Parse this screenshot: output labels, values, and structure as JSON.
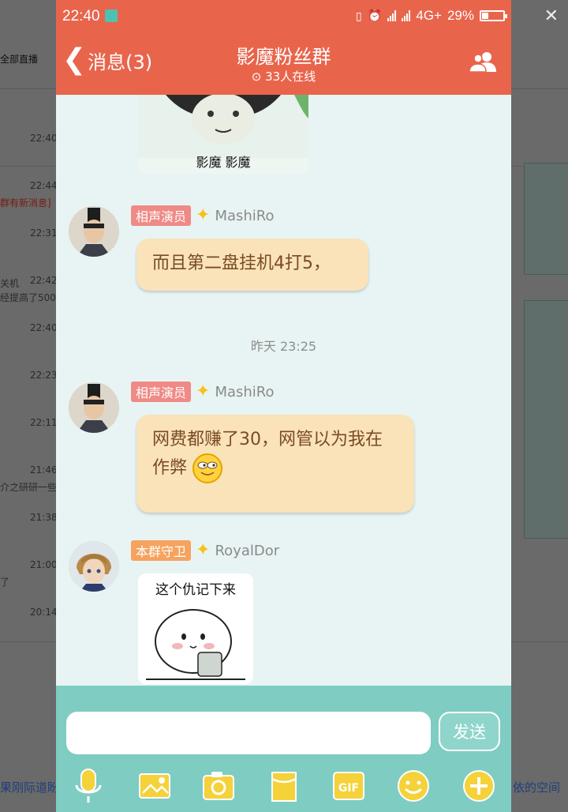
{
  "statusbar": {
    "time": "22:40",
    "network": "4G+",
    "battery": "29%",
    "battery_level": 0.29
  },
  "header": {
    "back_label": "消息(3)",
    "title": "影魔粉丝群",
    "online_count": "33人在线"
  },
  "messages": [
    {
      "sticker_caption": "影魔 影魔"
    },
    {
      "badge": "相声演员",
      "nickname": "MashiRo",
      "text": "而且第二盘挂机4打5，"
    },
    {
      "divider": "昨天 23:25"
    },
    {
      "badge": "相声演员",
      "nickname": "MashiRo",
      "text": "网费都赚了30，网管以为我在作弊"
    },
    {
      "badge": "本群守卫",
      "nickname": "RoyalDor",
      "sticker_caption": "这个仇记下来"
    }
  ],
  "input": {
    "placeholder": "",
    "send_label": "发送"
  },
  "toolbar": [
    "mic-icon",
    "image-icon",
    "camera-icon",
    "file-icon",
    "gif-icon",
    "emoji-icon",
    "plus-icon"
  ],
  "toolbar_gif_label": "GIF",
  "background_page": {
    "tab": "全部直播",
    "times": [
      "22:40",
      "22:44",
      "22:31",
      "22:42",
      "22:40",
      "22:23",
      "22:11",
      "21:46",
      "21:38",
      "21:00",
      "20:14"
    ],
    "snippets": [
      "群有新消息]",
      "关机",
      "经提高了500",
      "介之研研一些",
      "了"
    ],
    "bottom_left": "果刚际道盼",
    "bottom_right": "依的空间"
  },
  "colors": {
    "header": "#e8654c",
    "panel": "#7fccc2",
    "bubble": "#fae3b9",
    "bubble_text": "#7a4a26"
  }
}
